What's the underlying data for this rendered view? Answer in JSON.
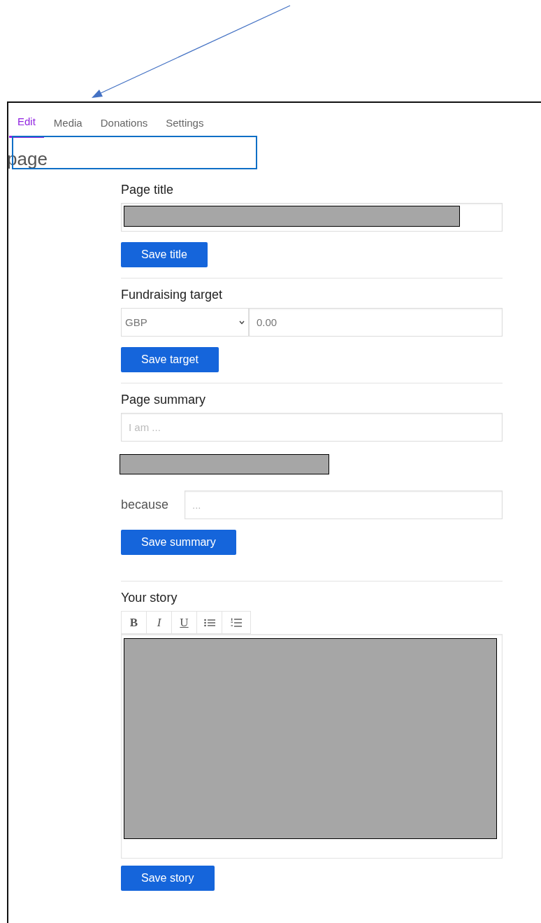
{
  "tabs": [
    {
      "label": "Edit",
      "selected": true
    },
    {
      "label": "Media",
      "selected": false
    },
    {
      "label": "Donations",
      "selected": false
    },
    {
      "label": "Settings",
      "selected": false
    }
  ],
  "heading": "page",
  "title_section": {
    "label": "Page title",
    "button": "Save title"
  },
  "target_section": {
    "label": "Fundraising target",
    "currency": "GBP",
    "amount": "0.00",
    "button": "Save target"
  },
  "summary_section": {
    "label": "Page summary",
    "placeholder": "I am ...",
    "because_label": "because",
    "because_placeholder": "...",
    "button": "Save summary"
  },
  "story_section": {
    "label": "Your story",
    "toolbar": [
      {
        "kind": "bold",
        "glyph": "B"
      },
      {
        "kind": "italic",
        "glyph": "I"
      },
      {
        "kind": "underline",
        "glyph": "U"
      },
      {
        "kind": "bullets"
      },
      {
        "kind": "numbers"
      }
    ],
    "button": "Save story"
  }
}
